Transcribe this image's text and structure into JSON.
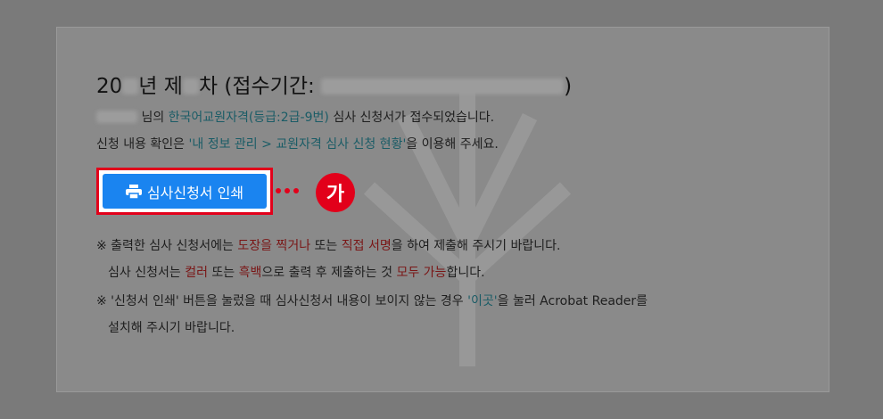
{
  "heading": {
    "prefix": "20",
    "year_suffix": "년 제",
    "round_suffix": "차 (접수기간:",
    "closing": ")"
  },
  "message": {
    "suffix_name": "님의",
    "cert_type": "한국어교원자격(등급:2급-9번)",
    "submitted": "심사 신청서가 접수되었습니다.",
    "check_prefix": "신청 내용 확인은",
    "check_path": "'내 정보 관리 > 교원자격 심사 신청 현황'",
    "check_suffix": "을 이용해 주세요."
  },
  "print_button": {
    "label": "심사신청서 인쇄",
    "icon": "printer-icon"
  },
  "callout": {
    "label": "가",
    "color": "#e2001a"
  },
  "notes": {
    "n1_a": "※ 출력한 심사 신청서에는",
    "n1_b": "도장을 찍거나",
    "n1_c": "또는",
    "n1_d": "직접 서명",
    "n1_e": "을 하여 제출해 주시기 바랍니다.",
    "n2_a": "심사 신청서는",
    "n2_b": "컬러",
    "n2_c": "또는",
    "n2_d": "흑백",
    "n2_e": "으로 출력 후 제출하는 것",
    "n2_f": "모두 가능",
    "n2_g": "합니다.",
    "n3_a": "※ '신청서 인쇄' 버튼을 눌렀을 때 심사신청서 내용이 보이지 않는 경우",
    "n3_b": "'이곳'",
    "n3_c": "을 눌러 Acrobat Reader를",
    "n4": "설치해 주시기 바랍니다."
  }
}
